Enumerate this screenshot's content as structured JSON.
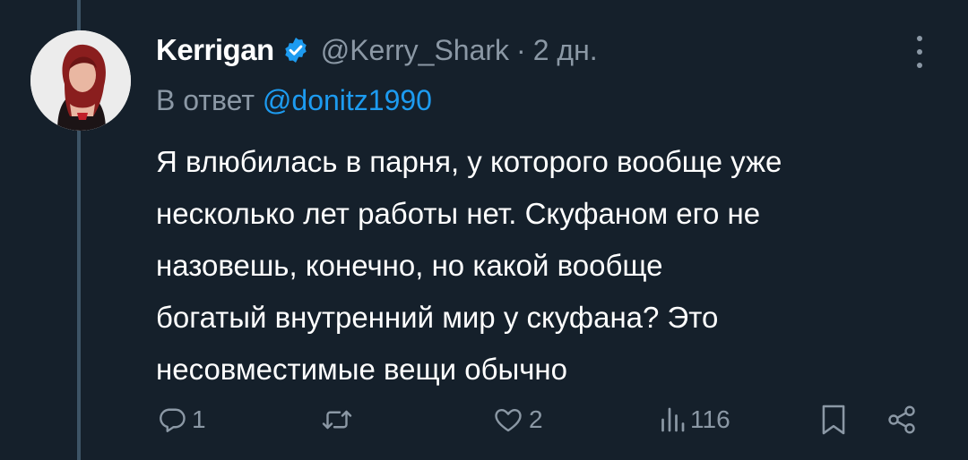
{
  "tweet": {
    "author_name": "Kerrigan",
    "author_handle": "@Kerry_Shark",
    "separator": "·",
    "time": "2 дн.",
    "reply_prefix": "В ответ",
    "reply_mention": "@donitz1990",
    "text_lines": [
      "Я влюбилась в парня, у которого вообще уже",
      "несколько лет работы нет. Скуфаном его не",
      "назовешь, конечно, но какой вообще",
      "богатый внутренний мир у скуфана? Это",
      "несовместимые вещи обычно"
    ]
  },
  "actions": {
    "reply_count": "1",
    "retweet_count": "",
    "like_count": "2",
    "views_count": "116"
  },
  "icons": {
    "verified": "verified-badge-icon",
    "more": "more-vertical-icon",
    "reply": "reply-icon",
    "retweet": "retweet-icon",
    "like": "heart-icon",
    "views": "views-icon",
    "bookmark": "bookmark-icon",
    "share": "share-icon"
  },
  "colors": {
    "background": "#15202b",
    "accent": "#1d9bf0",
    "muted": "#8b98a5",
    "thread_line": "#3d5466"
  }
}
